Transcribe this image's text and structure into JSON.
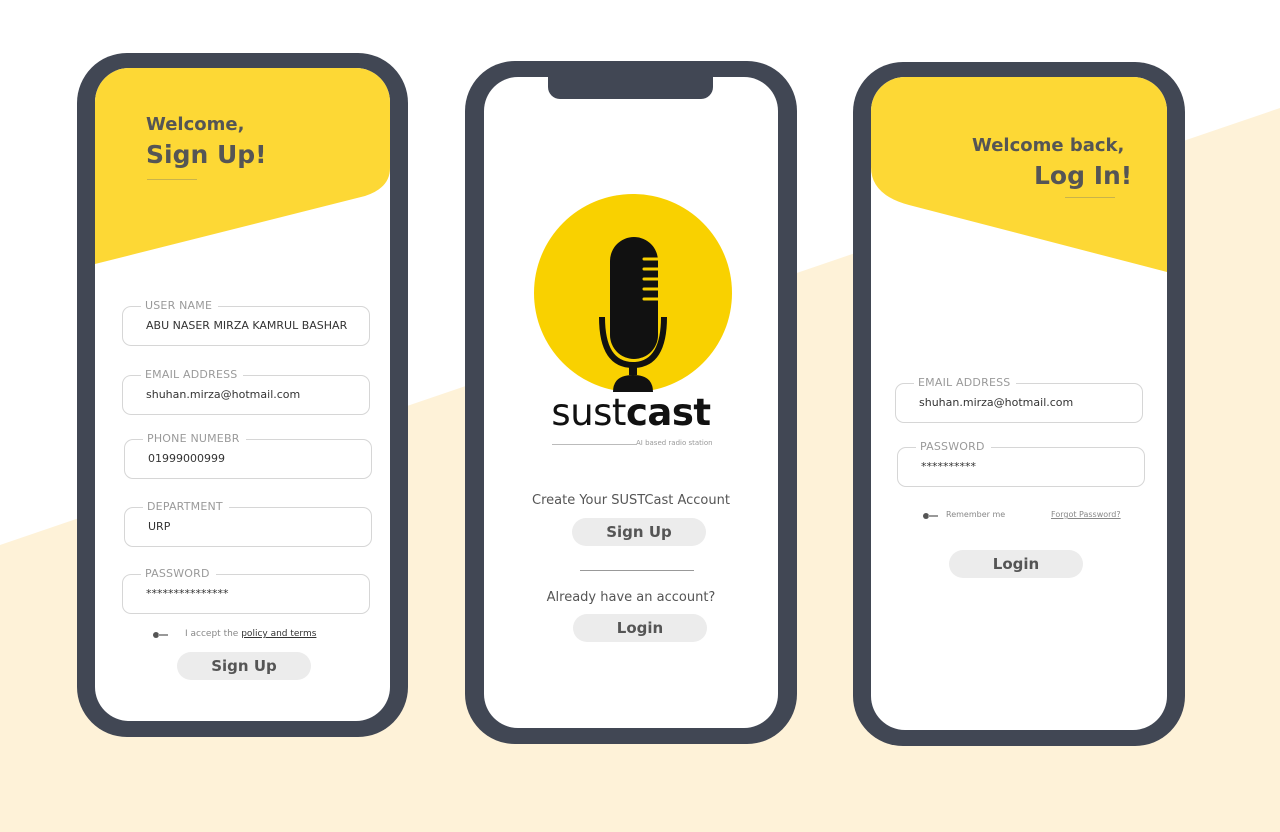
{
  "colors": {
    "accent_yellow": "#fdd835",
    "logo_yellow": "#f9d100",
    "phone_frame": "#414754",
    "background_band": "#fef2d8",
    "pill_button": "#ececec"
  },
  "signup_screen": {
    "greeting": "Welcome,",
    "title": "Sign Up!",
    "fields": [
      {
        "label": "USER NAME",
        "value": "ABU NASER MIRZA KAMRUL BASHAR"
      },
      {
        "label": "EMAIL ADDRESS",
        "value": "shuhan.mirza@hotmail.com"
      },
      {
        "label": "PHONE NUMEBR",
        "value": "01999000999"
      },
      {
        "label": "DEPARTMENT",
        "value": "URP"
      },
      {
        "label": "PASSWORD",
        "value": "***************"
      }
    ],
    "accept_text": "I accept the",
    "policy_link": "policy and terms",
    "button": "Sign Up"
  },
  "landing_screen": {
    "logo_icon": "microphone-icon",
    "brand_part1": "sust",
    "brand_part2": "cast",
    "tagline": "AI based radio station",
    "create_prompt": "Create Your SUSTCast Account",
    "signup_button": "Sign Up",
    "login_prompt": "Already have an account?",
    "login_button": "Login"
  },
  "login_screen": {
    "greeting": "Welcome back,",
    "title": "Log In!",
    "fields": [
      {
        "label": "EMAIL ADDRESS",
        "value": "shuhan.mirza@hotmail.com"
      },
      {
        "label": "PASSWORD",
        "value": "**********"
      }
    ],
    "remember_me": "Remember me",
    "forgot_password": "Forgot Password?",
    "button": "Login"
  }
}
